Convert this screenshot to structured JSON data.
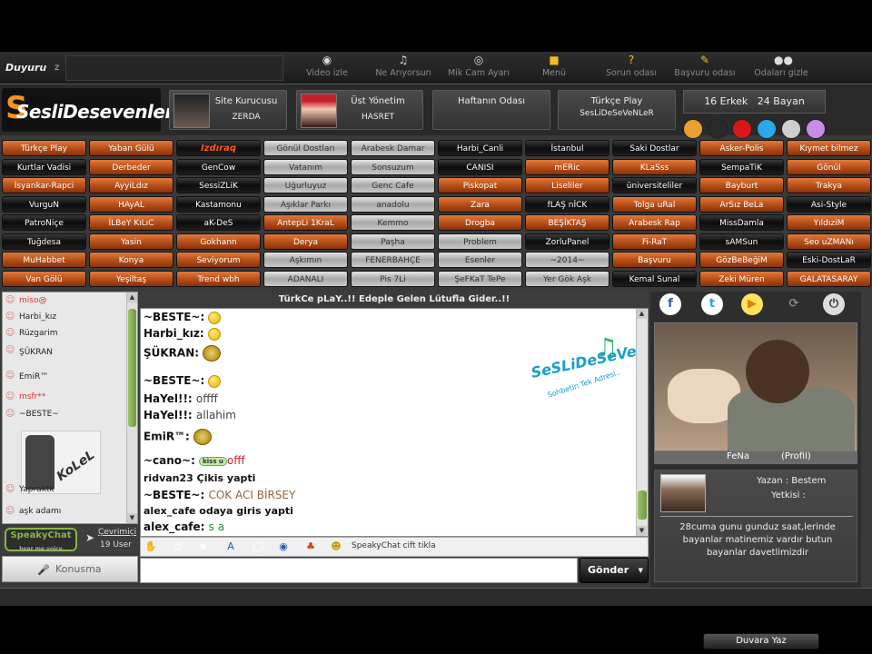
{
  "topbar": {
    "duyuru_label": "Duyuru",
    "duyuru_value": "z",
    "tools": [
      {
        "icon": "video-icon",
        "label": "Video izle"
      },
      {
        "icon": "music-icon",
        "label": "Ne Arıyorsun"
      },
      {
        "icon": "webcam-icon",
        "label": "Mik Cam Ayarı"
      },
      {
        "icon": "menu-icon",
        "label": "Menü"
      },
      {
        "icon": "question-user-icon",
        "label": "Sorun odası"
      },
      {
        "icon": "apply-user-icon",
        "label": "Başvuru odası"
      },
      {
        "icon": "hide-icon",
        "label": "Odaları gizle"
      }
    ]
  },
  "header": {
    "logo_text": "SesliDesevenler.Com",
    "founder": {
      "title": "Site Kurucusu",
      "name": "ZERDA"
    },
    "admin": {
      "title": "Üst Yönetim",
      "name": "HASRET"
    },
    "room_of_week": "Haftanın Odası",
    "featured": {
      "title": "Türkçe Play",
      "name": "SesLiDeSeVeNLeR"
    },
    "counts": {
      "male": "16 Erkek",
      "female": "24 Bayan"
    },
    "colors": [
      "#e8a030",
      "#2a2a2a",
      "#d81818",
      "#2aa8e8",
      "#cfcfcf",
      "#c88ce8"
    ]
  },
  "rooms": [
    [
      "Türkçe Play",
      "Yaban Gülü",
      "Izdıraq",
      "Gönül Dostları",
      "Arabesk Damar",
      "Harbi_Canli",
      "İstanbul",
      "Saki Dostlar",
      "Asker-Polis",
      "Kıymet bilmez"
    ],
    [
      "Kurtlar Vadisi",
      "Derbeder",
      "GenCow",
      "Vatanım",
      "Sonsuzum",
      "CANISI",
      "mERic",
      "KLaSss",
      "SempaTiK",
      "Gönül"
    ],
    [
      "İsyankar-Rapci",
      "AyyiLdız",
      "SessiZLiK",
      "Uğurluyuz",
      "Genc Cafe",
      "Piskopat",
      "Liseliler",
      "üniversiteliler",
      "Bayburt",
      "Trakya"
    ],
    [
      "VurguN",
      "HAyAL",
      "Kastamonu",
      "Aşıklar Parkı",
      "anadolu",
      "Zara",
      "fLAŞ nİCK",
      "Tolga uRal",
      "ArSız BeLa",
      "Asi-Style"
    ],
    [
      "PatroNiçe",
      "İLBeY KıLıC",
      "aK-DeS",
      "AntepLi 1KraL",
      "Kemmo",
      "Drogba",
      "BEŞİKTAŞ",
      "Arabesk Rap",
      "MissDamla",
      "YıldıziM"
    ],
    [
      "Tuğdesa",
      "Yasin",
      "Gokhann",
      "Derya",
      "Paşha",
      "Problem",
      "ZorluPanel",
      "Fi-RaT",
      "sAMSun",
      "Seo uZMANı"
    ],
    [
      "MuHabbet",
      "Konya",
      "Seviyorum",
      "Aşkımın",
      "FENERBAHÇE",
      "Esenler",
      "~2014~",
      "Başvuru",
      "GözBeBeğiM",
      "Eski-DostLaR"
    ],
    [
      "Van Gölü",
      "Yeşiltaş",
      "Trend wbh",
      "ADANALI",
      "Pis 7Li",
      "ŞeFKaT TePe",
      "Yer Gök Aşk",
      "Kemal Sunal",
      "Zeki Müren",
      "GALATASARAY"
    ]
  ],
  "userlist": {
    "users": [
      "miso@",
      "Harbi_kız",
      "Rüzgarim",
      "ŞÜKRAN",
      "EmiR™",
      "msfr**",
      "~BESTE~",
      "Yapraktk",
      "aşk adamı"
    ],
    "big_user_text": "KoLeL",
    "brand": "SpeakyChat",
    "brand_sub": "hear me voice",
    "online_label": "Çevrimiçi",
    "user_count": "19 User",
    "talk_button": "Konusma"
  },
  "chat": {
    "title": "TürkCe pLaY..!!  Edeple Gelen Lütufla Gider..!!",
    "messages": [
      {
        "name": "~BESTE~:",
        "text": "",
        "emote": "smile"
      },
      {
        "name": "Harbi_kız:",
        "text": "",
        "emote": "smile"
      },
      {
        "name": "ŞÜKRAN:",
        "text": "",
        "emote": "big"
      },
      {
        "name": "~BESTE~:",
        "text": "",
        "emote": "smile"
      },
      {
        "name": "HaYel!!:",
        "text": "offff",
        "emote": ""
      },
      {
        "name": "HaYel!!:",
        "text": "allahim",
        "emote": ""
      },
      {
        "name": "EmiR™:",
        "text": "",
        "emote": "big"
      },
      {
        "name": "~cano~:",
        "text": "offf",
        "emote": "kiss"
      },
      {
        "name": "ridvan23 Çikis yapti",
        "text": "",
        "emote": ""
      },
      {
        "name": "~BESTE~:",
        "text": "COK ACI BİRSEY",
        "emote": ""
      },
      {
        "name": "alex_cafe odaya giris yapti",
        "text": "",
        "emote": ""
      },
      {
        "name": "alex_cafe:",
        "text": "s a",
        "emote": ""
      }
    ],
    "kiss_badge": "kiss u",
    "watermark_title": "SeSLiDeSeVeNLeR",
    "watermark_sub": "Sohbetin Tek Adresi..",
    "icons_bar_text": "SpeakyChat cift tikla",
    "send_button": "Gönder"
  },
  "rightpanel": {
    "photo_name": "FeNa",
    "photo_link": "(Profil)",
    "author_label": "Yazan : Bestem",
    "authority_label": "Yetkisi :",
    "wall_message": "28cuma gunu gunduz saat,lerinde bayanlar matinemiz vardır butun bayanlar davetlimizdir",
    "wall_button": "Duvara  Yaz"
  }
}
